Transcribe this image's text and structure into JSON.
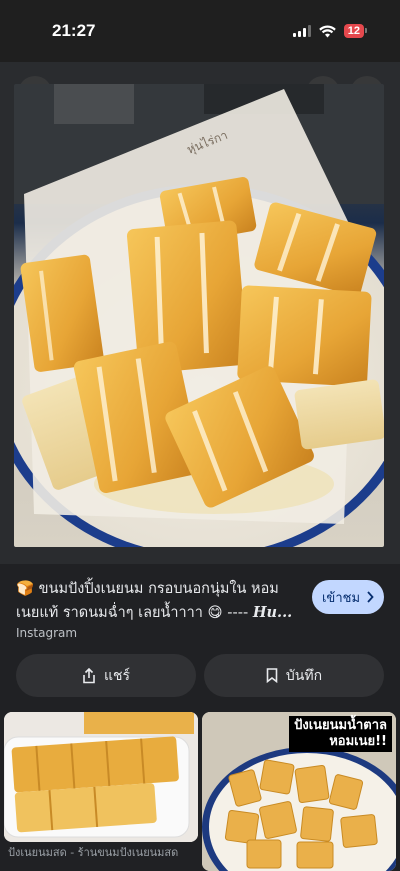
{
  "status_bar": {
    "time": "21:27",
    "battery": "12"
  },
  "hero": {
    "image_desc_icon": "photo-of-toast",
    "paper_text": "หุ่นไร่กา"
  },
  "result": {
    "emoji": "🍞",
    "caption": "ขนมปังปิ้งเนยนม กรอบนอกนุ่มใน หอมเนยแท้ ราดนมฉ่ำๆ เลยน้ำาาา 😋 ---- ",
    "caption_tail": "Hu...",
    "source": "Instagram",
    "visit_label": "เข้าชม"
  },
  "actions": {
    "share_label": "แชร์",
    "save_label": "บันทึก"
  },
  "related": [
    {
      "text": "ปังเนยนมสด - ร้านขนมปังเนยนมสด"
    },
    {
      "label_line1": "ปังเนยนมน้ำตาล",
      "label_line2": "หอมเนย!!"
    }
  ],
  "colors": {
    "background": "#202124",
    "pill": "#303134",
    "visit_button": "#c2d7ff",
    "battery": "#e5484d"
  }
}
